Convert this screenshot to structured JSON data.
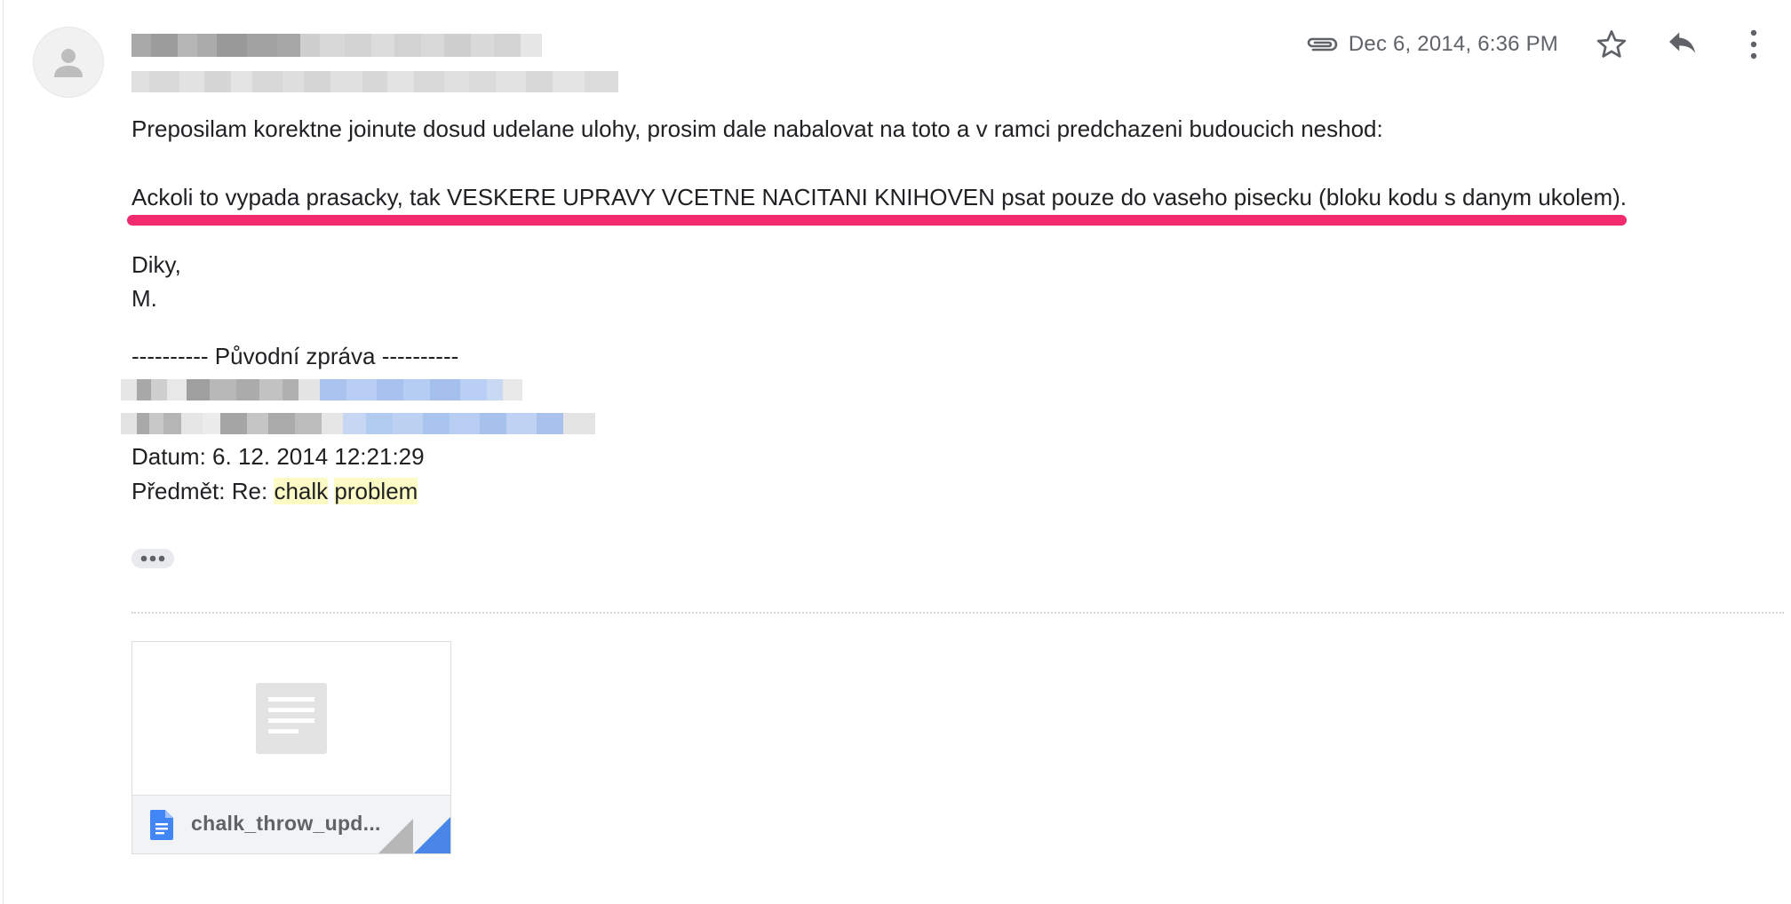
{
  "header": {
    "date": "Dec 6, 2014, 6:36 PM",
    "attachment_icon": "paperclip-icon",
    "star_icon": "star-outline-icon",
    "reply_icon": "reply-icon",
    "more_icon": "more-vert-icon"
  },
  "message": {
    "line1": "Preposilam korektne joinute dosud udelane ulohy, prosim dale nabalovat na toto a v ramci predchazeni budoucich neshod:",
    "line2": "Ackoli to vypada prasacky, tak VESKERE UPRAVY VCETNE NACITANI KNIHOVEN psat pouze do vaseho pisecku (bloku kodu s danym ukolem).",
    "signoff1": "Diky,",
    "signoff2": "M.",
    "highlight_color": "#f22a6e"
  },
  "forwarded": {
    "separator": "---------- Původní zpráva ----------",
    "datum_label": "Datum:",
    "datum_value": "6. 12. 2014 12:21:29",
    "subject_label": "Předmět:",
    "subject_prefix": "Re:",
    "subject_word1": "chalk",
    "subject_word2": "problem"
  },
  "attachment": {
    "filename": "chalk_throw_upd...",
    "file_icon": "google-docs-icon",
    "preview_icon": "document-thumbnail-icon"
  }
}
